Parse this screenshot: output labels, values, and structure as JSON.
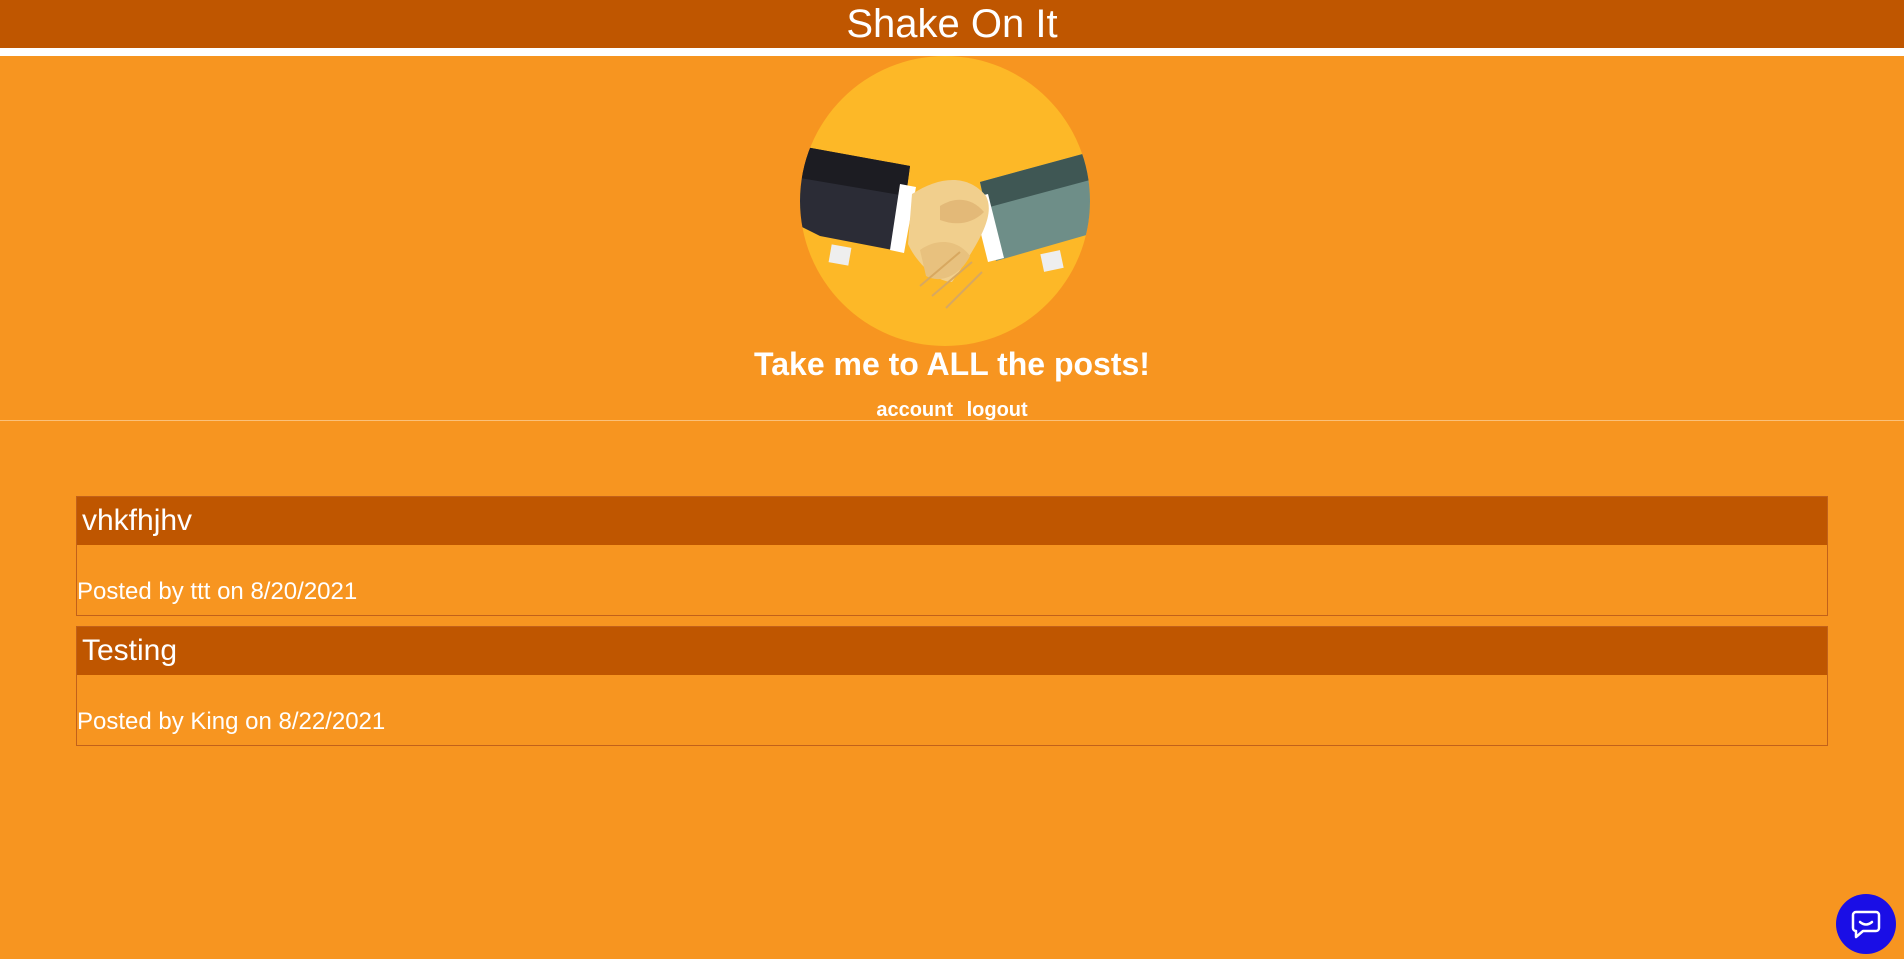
{
  "header": {
    "title": "Shake On It"
  },
  "hero": {
    "logo_icon": "handshake-icon",
    "all_posts_link": "Take me to ALL the posts!",
    "nav": {
      "account": "account",
      "logout": "logout"
    }
  },
  "posts": [
    {
      "title": "vhkfhjhv",
      "meta": "Posted by ttt on 8/20/2021"
    },
    {
      "title": "Testing",
      "meta": "Posted by King on 8/22/2021"
    }
  ],
  "chat": {
    "icon": "chat-bubble-icon"
  },
  "colors": {
    "header_bg": "#bf5600",
    "page_bg": "#f79520",
    "logo_circle": "#fdb827",
    "chat_button": "#1a0ee6"
  }
}
